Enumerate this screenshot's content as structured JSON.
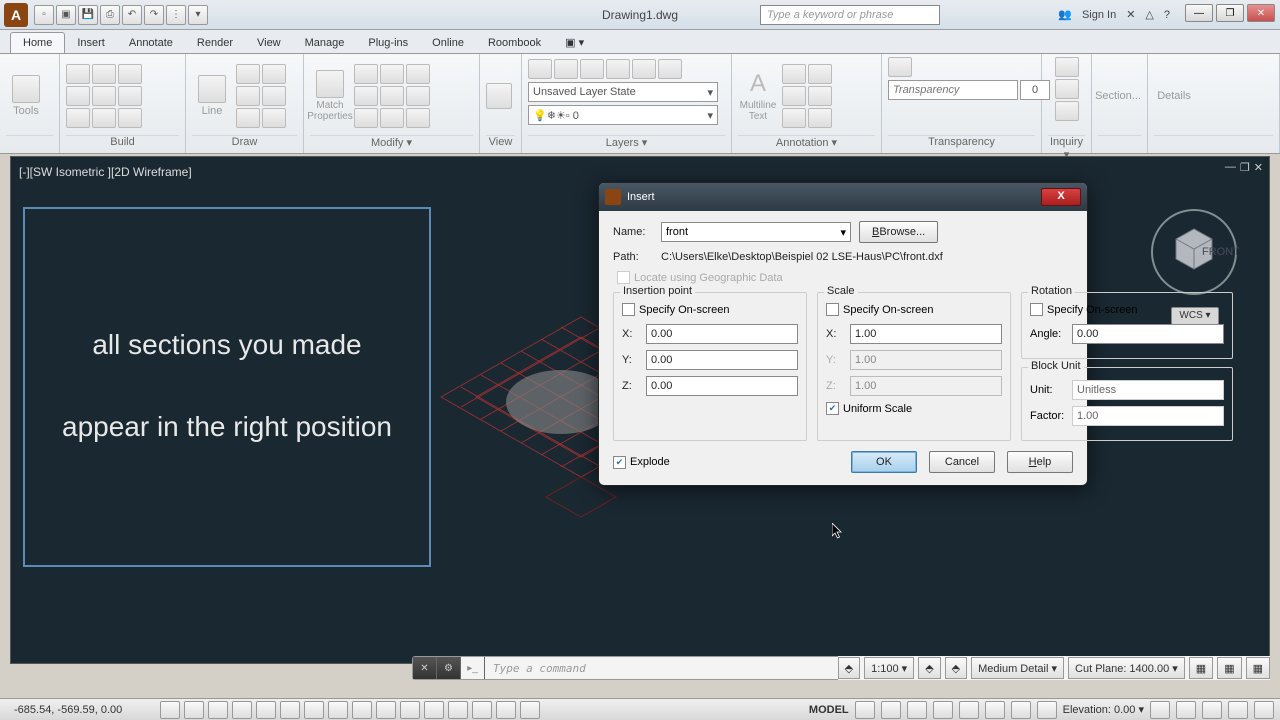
{
  "title": "Drawing1.dwg",
  "search_placeholder": "Type a keyword or phrase",
  "signin": "Sign In",
  "tabs": [
    "Home",
    "Insert",
    "Annotate",
    "Render",
    "View",
    "Manage",
    "Plug-ins",
    "Online",
    "Roombook"
  ],
  "active_tab": "Home",
  "panels": {
    "tools": "Tools",
    "build": "Build",
    "draw": "Draw",
    "line": "Line",
    "modify": "Modify ▾",
    "match_props": "Match\nProperties",
    "view": "View",
    "layers": "Layers ▾",
    "layer_state": "Unsaved Layer State",
    "layer_current": "0",
    "annotation": "Annotation ▾",
    "mtext": "Multiline\nText",
    "transparency": "Transparency",
    "transp_ph": "Transparency",
    "transp_val": "0",
    "inquiry": "Inquiry ▾",
    "section": "Section...",
    "details": "Details"
  },
  "canvas": {
    "label": "[-][SW Isometric ][2D Wireframe]",
    "hint1": "all sections you made",
    "hint2": "appear in the right position",
    "wcs": "WCS ▾"
  },
  "dialog": {
    "title": "Insert",
    "name_lbl": "Name:",
    "name_val": "front",
    "browse": "Browse...",
    "path_lbl": "Path:",
    "path_val": "C:\\Users\\Elke\\Desktop\\Beispiel 02 LSE-Haus\\PC\\front.dxf",
    "geo": "Locate using Geographic Data",
    "ins_title": "Insertion point",
    "specify": "Specify On-screen",
    "x_lbl": "X:",
    "y_lbl": "Y:",
    "z_lbl": "Z:",
    "ins_x": "0.00",
    "ins_y": "0.00",
    "ins_z": "0.00",
    "scale_title": "Scale",
    "scale_x": "1.00",
    "scale_y": "1.00",
    "scale_z": "1.00",
    "uniform": "Uniform Scale",
    "rot_title": "Rotation",
    "angle_lbl": "Angle:",
    "angle_val": "0.00",
    "bu_title": "Block Unit",
    "unit_lbl": "Unit:",
    "unit_val": "Unitless",
    "factor_lbl": "Factor:",
    "factor_val": "1.00",
    "explode": "Explode",
    "ok": "OK",
    "cancel": "Cancel",
    "help": "Help"
  },
  "cmd": {
    "placeholder": "Type a command"
  },
  "rstatus": {
    "scale": "1:100 ▾",
    "detail": "Medium Detail ▾",
    "cutplane": "Cut Plane: 1400.00 ▾"
  },
  "statusbar": {
    "coords": "-685.54, -569.59, 0.00",
    "model": "MODEL",
    "elevation": "Elevation: 0.00 ▾"
  }
}
